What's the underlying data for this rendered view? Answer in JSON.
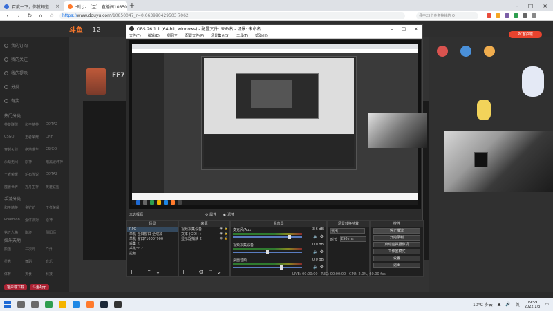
{
  "browser": {
    "tabs": [
      {
        "label": "百度一下，你就知道",
        "favicon_color": "#3b6fd8",
        "active": false
      },
      {
        "label": "卡比 - 【互】 直播间10850047 - ...",
        "favicon_color": "#ff7a2c",
        "active": true
      }
    ],
    "new_tab": "+",
    "url_secure": "https://",
    "url_host": "www.douyu.com",
    "url_path": "/10850047_r=0.663990429503 7062",
    "search_placeholder": "县中23个金条换钱的 Q"
  },
  "douyu": {
    "logo_text": "斗鱼",
    "room_number": "12",
    "streamer_short": "FF7",
    "pc_badge": "PC客户端",
    "sidebar": {
      "top_items": [
        "我的订阅",
        "我的关注",
        "我的提示",
        "分类",
        "有奖"
      ],
      "section1_title": "热门分类",
      "section1_items": [
        "英雄联盟",
        "和平精英",
        "DOTA2",
        "CSGO",
        "王者荣耀",
        "DNF",
        "穿越火线",
        "绝地求生",
        "CS/GO",
        "永劫无间",
        "原神",
        "暗黑破坏神",
        "王者荣耀",
        "炉石传说",
        "DOTA2",
        "魔兽世界",
        "方舟生存",
        "英雄联盟"
      ],
      "section2_title": "手游分类",
      "section2_items": [
        "和平精英",
        "金铲铲",
        "王者荣耀",
        "Pokemon",
        "蛋仔派对",
        "原神",
        "第五人格",
        "崩坏",
        "阴阳师"
      ],
      "section3_title": "娱乐天地",
      "section3_items": [
        "颜值",
        "二次元",
        "户外",
        "星秀",
        "舞蹈",
        "音乐",
        "体育",
        "美食",
        "科技"
      ],
      "bottom_buttons": [
        "客户端下载",
        "斗鱼App"
      ]
    }
  },
  "obs": {
    "title": "OBS 26.1.1 (64-bit, windows) - 配置文件: 未命名 - 场景: 未命名",
    "menu": [
      "文件(F)",
      "编辑(E)",
      "视图(V)",
      "配置文件(P)",
      "场景集合(S)",
      "工具(T)",
      "帮助(H)"
    ],
    "no_source_label": "未选择源",
    "tab_properties": "属性",
    "tab_filters": "滤镜",
    "scenes": {
      "title": "场景",
      "items": [
        "RPG",
        "单机 全屏窗口 全成加",
        "单机 窗口?1600*900",
        "采集卡",
        "采集卡 2",
        "拉帧"
      ],
      "selected_index": 0
    },
    "sources": {
      "title": "来源",
      "items": [
        "视频采集设备",
        "文本 (GDI+)",
        "显示器捕获 2"
      ]
    },
    "mixer": {
      "title": "混音器",
      "channels": [
        {
          "name": "麦克风/Aux",
          "db": "-3.6 dB",
          "level": 0.82
        },
        {
          "name": "视频采集设备",
          "db": "0.0 dB",
          "level": 0.5
        },
        {
          "name": "桌面音频",
          "db": "0.0 dB",
          "level": 0.7
        }
      ]
    },
    "transitions": {
      "title": "场景转换特效",
      "selected": "淡出",
      "duration_label": "时长",
      "duration_value": "250 ms"
    },
    "controls": {
      "title": "控件",
      "buttons": [
        "停止推流",
        "开始录制",
        "启动虚拟摄像机",
        "工作室模式",
        "设置",
        "退出"
      ]
    },
    "status": {
      "live": "LIVE: 00:00:00",
      "rec": "REC: 00:00:00",
      "cpu": "CPU: 2.0%, 60.00 fps"
    }
  },
  "taskbar": {
    "apps": [
      {
        "name": "search",
        "color": "#6a6a6a"
      },
      {
        "name": "task-view",
        "color": "#6a6a6a"
      },
      {
        "name": "chrome",
        "color": "#2e9e4f"
      },
      {
        "name": "qq",
        "color": "#f4b400"
      },
      {
        "name": "edge",
        "color": "#1e88e5"
      },
      {
        "name": "douyu",
        "color": "#ff7a2c"
      },
      {
        "name": "steam",
        "color": "#1b2838"
      },
      {
        "name": "obs",
        "color": "#333333"
      }
    ],
    "weather": "10°C 多云",
    "ime": "英",
    "time": "19:59",
    "date": "2022/1/3"
  }
}
